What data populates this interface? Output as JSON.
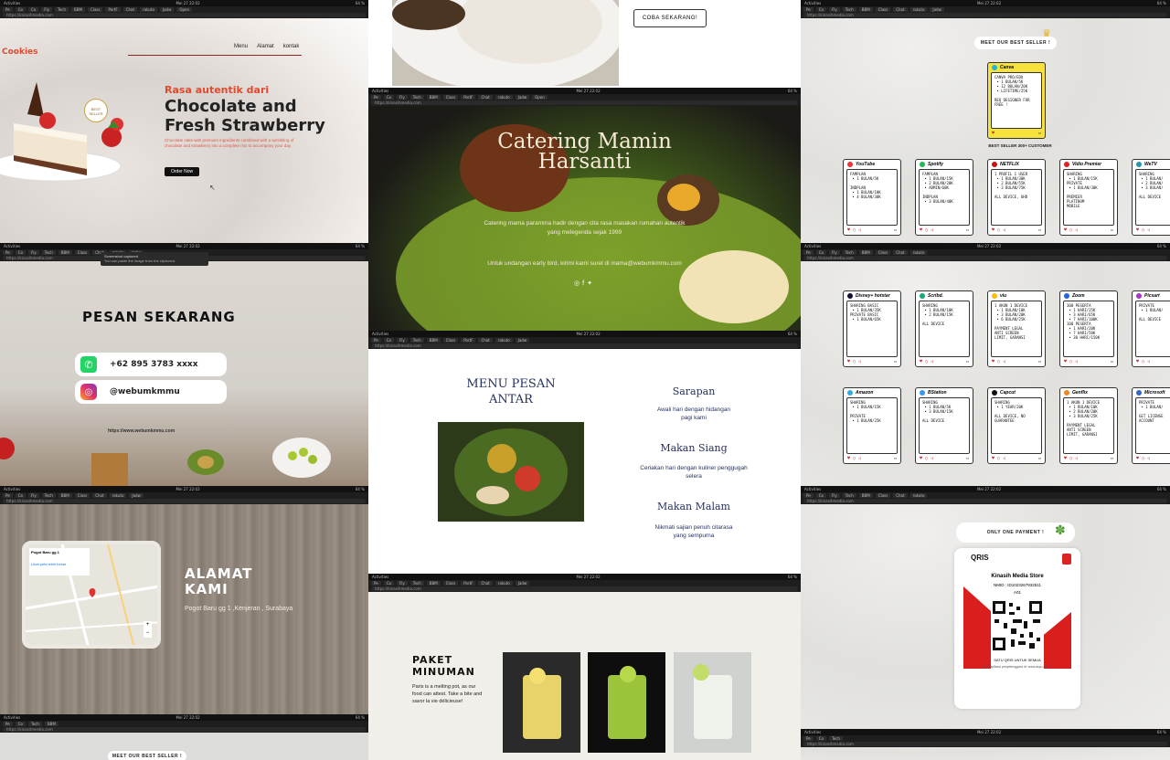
{
  "chrome": {
    "activities": "Activities",
    "app": "Google Chrome",
    "clock": "Mei 27  22:02",
    "status": "64 %",
    "url": "https://kinasihmedia.com",
    "tabs": [
      "Pe",
      "Co",
      "Co",
      "Fly",
      "Tech",
      "BBM",
      "Class",
      "PortF",
      "Chat",
      "rakuto",
      "Jadw",
      "Open"
    ]
  },
  "cake": {
    "brand": "Cookies",
    "nav": [
      "Menu",
      "Alamat",
      "kontak"
    ],
    "tagline": "Rasa autentik dari",
    "headline": "Chocolate and Fresh Strawberry",
    "desc": "Chocolate cake with premium ingredients combined with a sprinkling of chocolate and strawberry into a complete mix to accompany your day",
    "order": "Order Now",
    "badge": "BEST SELLER"
  },
  "pesan": {
    "toast_title": "Screenshot captured",
    "toast_body": "You can paste the image from the clipboard.",
    "title": "PESAN SEKARANG",
    "whatsapp": "+62 895 3783 xxxx",
    "instagram": "@webumkmmu",
    "link": "https://www.webumkmmu.com"
  },
  "alamat": {
    "title": "ALAMAT KAMI",
    "address": "Pogot Baru gg 1 ,Kenjeran , Surabaya",
    "map_place": "Pogot Baru gg 1",
    "map_link": "Lihat peta lebih besar"
  },
  "catering": {
    "top_button": "COBA SEKARANG!",
    "title": "Catering Mamin Harsanti",
    "desc": "Catering mama paramma hadir dengan cita rasa masakan rumahan autentik yang melegenda sejak 1999",
    "contact": "Untuk undangan early bird, kirimi kami surel di mama@webumkmmu.com"
  },
  "menu": {
    "title": "MENU PESAN ANTAR",
    "items": [
      {
        "name": "Sarapan",
        "desc": "Awali hari dengan hidangan pagi kami"
      },
      {
        "name": "Makan Siang",
        "desc": "Ceriakan hari dengan kuliner penggugah selera"
      },
      {
        "name": "Makan Malam",
        "desc": "Nikmati sajian penuh citarasa yang sempurna"
      }
    ]
  },
  "minuman": {
    "title": "PAKET MINUMAN",
    "desc": "Paris is a melting pot, as our food can attest. Take a bite and savor la vie délicieuse!"
  },
  "seller": {
    "meet": "MEET OUR BEST SELLER !",
    "best": "BEST SELLER 300+ CUSTOMER",
    "only_one": "ONLY ONE PAYMENT !",
    "canva": {
      "name": "Canva",
      "body": "CANVA PRO/EDU\n • 1 BULAN/5K\n • 12 BULAN/20K\n • LIFETIME/25K\n\nREQ DESIGNER FOR\nFREE !",
      "color": "#f7e23c"
    },
    "row1": [
      {
        "name": "YouTube",
        "body": "FAMPLAN\n • 1 BULAN/5K\n\nINDPLAN\n • 1 BULAN/10K\n • 4 BULAN/30K",
        "color": "#e33"
      },
      {
        "name": "Spotify",
        "body": "FAMPLAN\n • 1 BULAN/15K\n • 2 BULAN/20K\n • ADMIN/60K\n\nINDPLAN\n • 3 BULAN/40K",
        "color": "#1db954"
      },
      {
        "name": "NETFLIX",
        "body": "1 PROFIL 1 USER\n • 1 BULAN/30K\n • 2 BULAN/55K\n • 3 BULAN/75K\n\nALL DEVICE, UHD",
        "color": "#c11"
      },
      {
        "name": "Vidio Premier",
        "body": "SHARING\n • 1 BULAN/15K\nPRIVATE\n • 1 BULAN/30K\n\nPREMIER\nPLATINUM\nMOBILE",
        "color": "#d22"
      },
      {
        "name": "WeTV",
        "body": "SHARING\n • 1 BULAN/\n • 2 BULAN/\n • 3 BULAN/\n\nALL DEVICE",
        "color": "#29a"
      }
    ],
    "row2": [
      {
        "name": "Disney+ hotstar",
        "body": "SHARING BASIC\n • 1 BULAN/35K\nPRIVATE BASIC\n • 1 BULAN/65K",
        "color": "#113"
      },
      {
        "name": "Scribd.",
        "body": "SHARING\n • 1 BULAN/10K\n • 2 BULAN/15K\n\nALL DEVICE",
        "color": "#1a7"
      },
      {
        "name": "viu",
        "body": "1 AKUN 1 DEVICE\n • 1 BULAN/10K\n • 3 BULAN/20K\n • 6 BULAN/25K\n\nPAYMENT LEGAL\nANTI SCREEN\nLIMIT, GARANSI",
        "color": "#fb0"
      },
      {
        "name": "Zoom",
        "body": "300 PESERTA\n • 1 HARI/25K\n • 3 HARI/65K\n • 7 HARI/100K\n100 PESERTA\n • 1 HARI/20K\n • 7 HARI/50K\n • 30 HARI/150K",
        "color": "#26d"
      },
      {
        "name": "Picsart",
        "body": "PRIVATE\n • 1 BULAN/\n\nALL DEVICE",
        "color": "#a3c"
      }
    ],
    "row3": [
      {
        "name": "Amazon",
        "body": "SHARING\n • 1 BULAN/15K\n\nPRIVATE\n • 1 BULAN/25K",
        "color": "#3ad"
      },
      {
        "name": "BStation",
        "body": "SHARING\n • 1 BULAN/5K\n • 3 BULAN/15K\n\nALL DEVICE",
        "color": "#39e"
      },
      {
        "name": "Capcut",
        "body": "SHARING\n • 1 YEAR/20K\n\nALL DEVICE, NO\nGUARANTEE",
        "color": "#111"
      },
      {
        "name": "Genflix",
        "body": "1 AKUN 1 DEVICE\n • 1 BULAN/10K\n • 2 BULAN/20K\n • 3 BULAN/25K\n\nPAYMENT LEGAL\nANTI SCREEN\nLIMIT, GARANSI",
        "color": "#e82"
      },
      {
        "name": "Microsoft",
        "body": "PRIVATE\n • 1 BULAN/\n\nGET LICENSE\nACCOUNT",
        "color": "#36c"
      }
    ],
    "qris": {
      "brand": "QRIS",
      "store": "Kinasih Media Store",
      "nmid": "NMID : ID1023267932511",
      "code": "A01",
      "footer": "SATU QRIS UNTUK SEMUA",
      "note": "Cek aplikasi penyelenggara di: www.aspi-qris.id"
    }
  }
}
